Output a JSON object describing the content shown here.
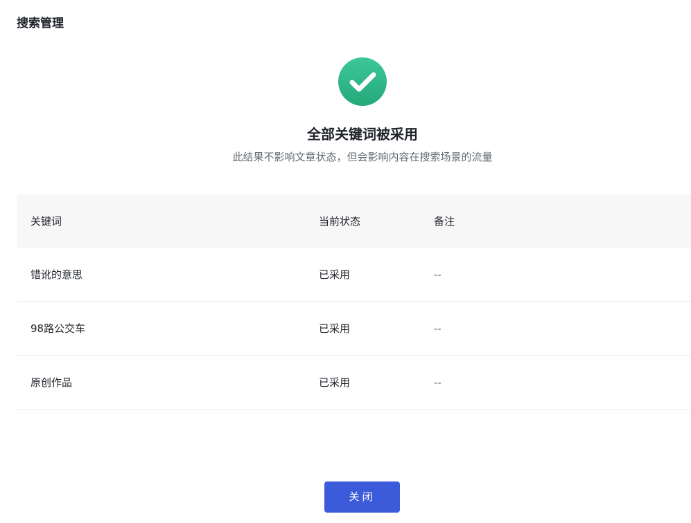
{
  "header": {
    "title": "搜索管理"
  },
  "result": {
    "icon": "check-circle-icon",
    "icon_color": "#31b88a",
    "title": "全部关键词被采用",
    "subtitle": "此结果不影响文章状态，但会影响内容在搜索场景的流量"
  },
  "table": {
    "columns": [
      "关键词",
      "当前状态",
      "备注"
    ],
    "rows": [
      {
        "keyword": "错讹的意思",
        "status": "已采用",
        "note": "--"
      },
      {
        "keyword": "98路公交车",
        "status": "已采用",
        "note": "--"
      },
      {
        "keyword": "原创作品",
        "status": "已采用",
        "note": "--"
      }
    ]
  },
  "footer": {
    "close_label": "关闭",
    "button_color": "#3b5bdb"
  }
}
